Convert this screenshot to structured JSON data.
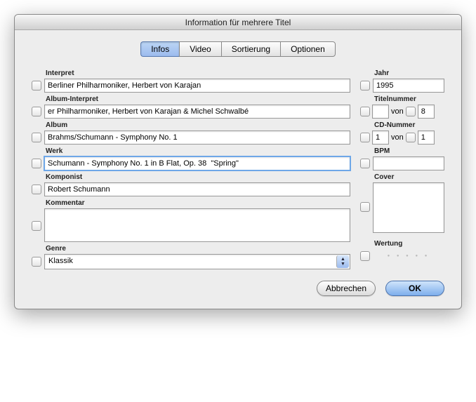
{
  "window": {
    "title": "Information für mehrere Titel"
  },
  "tabs": {
    "infos": "Infos",
    "video": "Video",
    "sort": "Sortierung",
    "options": "Optionen"
  },
  "labels": {
    "interpret": "Interpret",
    "albuminterpret": "Album-Interpret",
    "album": "Album",
    "werk": "Werk",
    "komponist": "Komponist",
    "kommentar": "Kommentar",
    "genre": "Genre",
    "jahr": "Jahr",
    "titelnummer": "Titelnummer",
    "cdnummer": "CD-Nummer",
    "bpm": "BPM",
    "cover": "Cover",
    "wertung": "Wertung",
    "von": "von"
  },
  "values": {
    "interpret": "Berliner Philharmoniker, Herbert von Karajan",
    "albuminterpret": "er Philharmoniker, Herbert von Karajan & Michel Schwalbé",
    "album": "Brahms/Schumann - Symphony No. 1",
    "werk": "Schumann - Symphony No. 1 in B Flat, Op. 38  \"Spring\"",
    "komponist": "Robert Schumann",
    "kommentar": "",
    "genre": "Klassik",
    "jahr": "1995",
    "track_a": "",
    "track_b": "8",
    "cd_a": "1",
    "cd_b": "1",
    "bpm": ""
  },
  "buttons": {
    "cancel": "Abbrechen",
    "ok": "OK"
  }
}
